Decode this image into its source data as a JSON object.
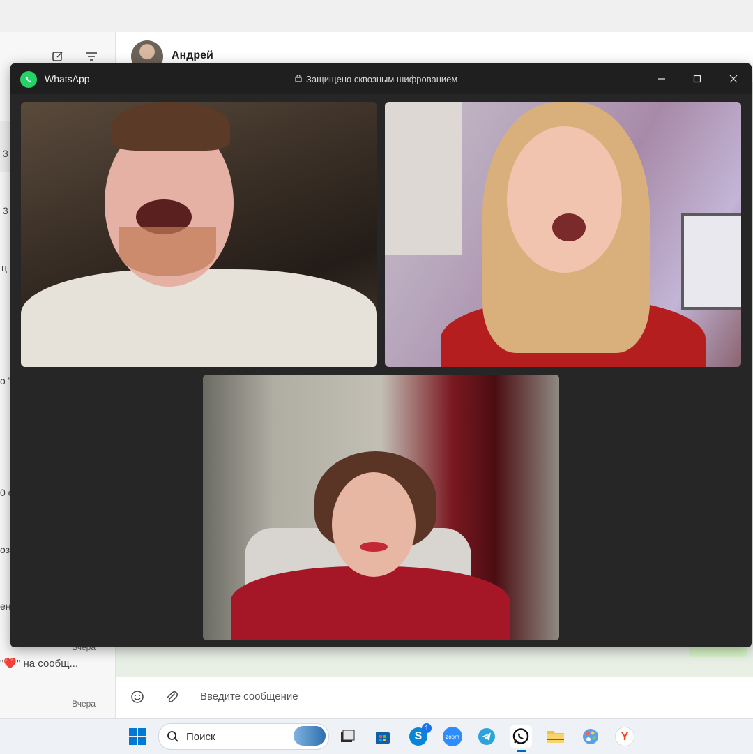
{
  "background_app": {
    "contact_name": "Андрей",
    "sidebar_fragments": [
      "3",
      "3",
      "ц",
      "о \"",
      "0 с",
      "оз",
      "ен"
    ],
    "chat_list": [
      {
        "time": "Вчера",
        "preview": "\"❤️\" на сообщ..."
      },
      {
        "time": "Вчера",
        "preview": ""
      }
    ],
    "composer_placeholder": "Введите сообщение"
  },
  "call_window": {
    "app_title": "WhatsApp",
    "encryption_label": "Защищено сквозным шифрованием",
    "participants_count": 3
  },
  "taskbar": {
    "search_placeholder": "Поиск",
    "apps": [
      {
        "name": "start",
        "icon": "windows-start-icon"
      },
      {
        "name": "task-view",
        "icon": "task-view-icon"
      },
      {
        "name": "store",
        "icon": "microsoft-store-icon"
      },
      {
        "name": "skype",
        "icon": "skype-icon",
        "badge": "1"
      },
      {
        "name": "zoom",
        "icon": "zoom-icon",
        "label": "zoom"
      },
      {
        "name": "telegram",
        "icon": "telegram-icon"
      },
      {
        "name": "whatsapp",
        "icon": "whatsapp-icon",
        "active": true
      },
      {
        "name": "file-explorer",
        "icon": "folder-icon"
      },
      {
        "name": "paint",
        "icon": "palette-icon"
      },
      {
        "name": "yandex",
        "icon": "yandex-browser-icon",
        "label": "Y"
      }
    ]
  },
  "colors": {
    "whatsapp_green": "#25d366",
    "call_window_bg": "#262626",
    "taskbar_accent": "#0067c0"
  }
}
